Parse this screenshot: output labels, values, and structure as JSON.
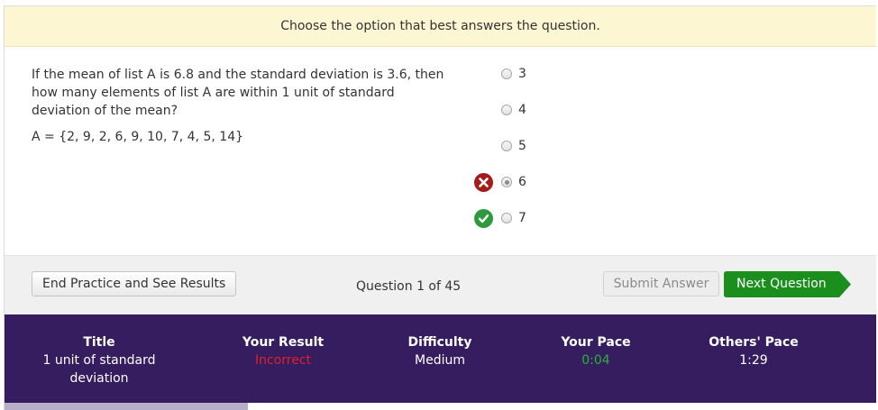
{
  "instruction": "Choose the option that best answers the question.",
  "question": {
    "text": "If the mean of list A is 6.8 and the standard deviation is 3.6, then how many elements of list A are within 1 unit of standard deviation of the mean?",
    "set": "A = {2, 9, 2, 6, 9, 10, 7, 4, 5, 14}"
  },
  "options": [
    {
      "label": "3",
      "selected": false,
      "mark": ""
    },
    {
      "label": "4",
      "selected": false,
      "mark": ""
    },
    {
      "label": "5",
      "selected": false,
      "mark": ""
    },
    {
      "label": "6",
      "selected": true,
      "mark": "x-circle-icon"
    },
    {
      "label": "7",
      "selected": false,
      "mark": "check-circle-icon"
    }
  ],
  "toolbar": {
    "end_label": "End Practice and See Results",
    "counter": "Question 1 of 45",
    "submit_label": "Submit Answer",
    "next_label": "Next Question"
  },
  "stats": {
    "title": {
      "label": "Title",
      "value": "1 unit of standard deviation"
    },
    "result": {
      "label": "Your Result",
      "value": "Incorrect"
    },
    "difficulty": {
      "label": "Difficulty",
      "value": "Medium"
    },
    "your_pace": {
      "label": "Your Pace",
      "value": "0:04"
    },
    "others_pace": {
      "label": "Others' Pace",
      "value": "1:29"
    }
  },
  "colors": {
    "instruction_bg": "#fdf6d3",
    "stats_bg": "#361d5f",
    "next_button": "#1a8f1e",
    "incorrect": "#e0202a",
    "pace": "#2fae3f"
  }
}
